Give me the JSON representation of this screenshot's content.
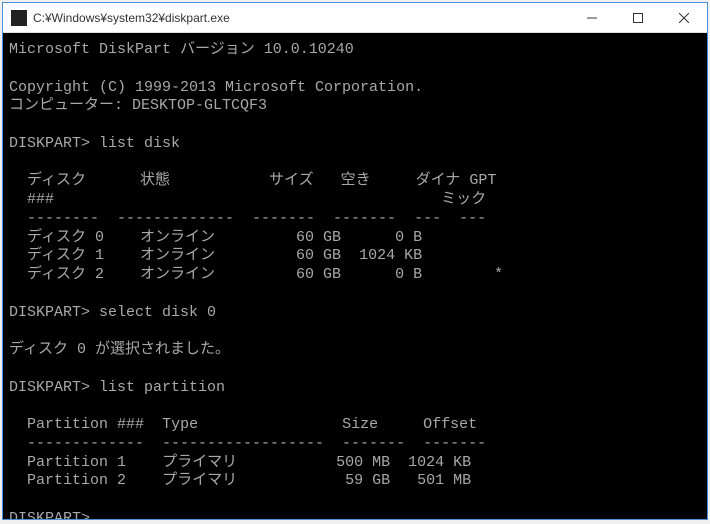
{
  "window": {
    "title": "C:¥Windows¥system32¥diskpart.exe"
  },
  "header": {
    "version_line": "Microsoft DiskPart バージョン 10.0.10240",
    "copyright": "Copyright (C) 1999-2013 Microsoft Corporation.",
    "computer_label": "コンピューター:",
    "computer_name": "DESKTOP-GLTCQF3"
  },
  "prompt": "DISKPART>",
  "cmd1": "list disk",
  "disk_table": {
    "headers": {
      "disk_num": "ディスク",
      "hash": "###",
      "status": "状態",
      "size": "サイズ",
      "free": "空き",
      "dyn1": "ダイナ",
      "dyn2": "ミック",
      "gpt": "GPT"
    },
    "sep": "  --------  -------------  -------  -------  ---  ---",
    "rows": [
      {
        "name": "ディスク 0",
        "status": "オンライン",
        "size": "60 GB",
        "free": "0 B",
        "dyn": "",
        "gpt": ""
      },
      {
        "name": "ディスク 1",
        "status": "オンライン",
        "size": "60 GB",
        "free": "1024 KB",
        "dyn": "",
        "gpt": ""
      },
      {
        "name": "ディスク 2",
        "status": "オンライン",
        "size": "60 GB",
        "free": "0 B",
        "dyn": "",
        "gpt": "*"
      }
    ]
  },
  "cmd2": "select disk 0",
  "msg_selected": "ディスク 0 が選択されました。",
  "cmd3": "list partition",
  "part_table": {
    "headers": {
      "part_num": "Partition ###",
      "type": "Type",
      "size": "Size",
      "offset": "Offset"
    },
    "sep": "  -------------  ------------------  -------  -------",
    "rows": [
      {
        "name": "Partition 1",
        "type": "プライマリ",
        "size": "500 MB",
        "offset": "1024 KB"
      },
      {
        "name": "Partition 2",
        "type": "プライマリ",
        "size": "59 GB",
        "offset": "501 MB"
      }
    ]
  }
}
